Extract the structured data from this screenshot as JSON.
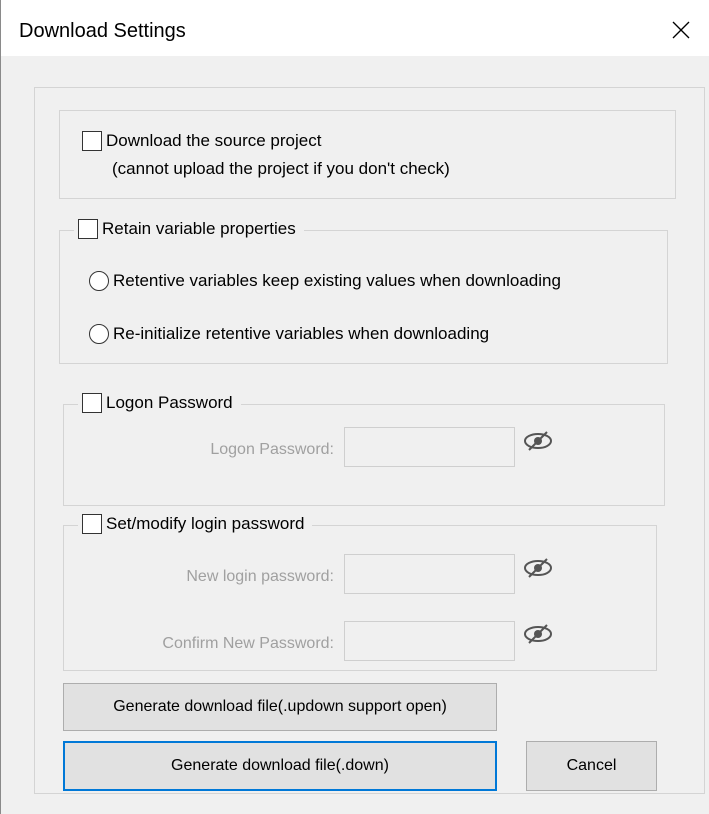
{
  "window": {
    "title": "Download Settings"
  },
  "source_project": {
    "label": "Download the source project",
    "note": "(cannot upload the project if you don't check)",
    "checked": false
  },
  "retain_variables": {
    "label": "Retain variable properties",
    "checked": false,
    "options": [
      {
        "label": "Retentive variables keep existing values when downloading",
        "selected": false
      },
      {
        "label": "Re-initialize retentive variables when downloading",
        "selected": false
      }
    ]
  },
  "logon_password": {
    "label": "Logon Password",
    "checked": false,
    "field_label": "Logon Password:",
    "field_value": ""
  },
  "login_password": {
    "label": "Set/modify login password",
    "checked": false,
    "new_label": "New login password:",
    "new_value": "",
    "confirm_label": "Confirm New Password:",
    "confirm_value": ""
  },
  "buttons": {
    "generate_updown": "Generate download file(.updown support open)",
    "generate_down": "Generate download file(.down)",
    "cancel": "Cancel"
  },
  "icons": {
    "close": "close-icon",
    "visibility": "eye-slash-icon"
  },
  "colors": {
    "dialog_background": "#f0f0f0",
    "title_background": "#ffffff",
    "default_button_border": "#0078d7",
    "disabled_text": "#a0a0a0"
  }
}
